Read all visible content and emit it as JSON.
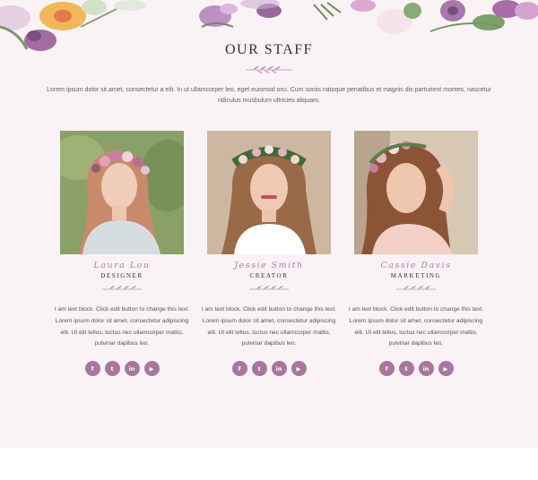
{
  "section": {
    "title": "OUR STAFF",
    "intro": "Lorem ipsum dolor sit amet, consectetur a elit. In ut ullamcorper leo, eget euismod orci. Cum sociis natoque penatibus et magnis dis parturient montes, nascetur ridiculus musbulum ultricies aliquam."
  },
  "colors": {
    "accent": "#a7779e",
    "name": "#b07ca8",
    "background": "#faf3f5"
  },
  "staff": [
    {
      "name": "Laura Lou",
      "role": "DESIGNER",
      "bio": "I am text block. Click edit button to change this text. Lorem ipsum dolor sit amet, consectetur adipiscing elit. Ut elit tellus, luctus nec ullamcorper mattis, pulvinar dapibus leo.",
      "socials": [
        {
          "icon": "facebook-icon",
          "glyph": "f"
        },
        {
          "icon": "twitter-icon",
          "glyph": "t"
        },
        {
          "icon": "linkedin-icon",
          "glyph": "in"
        },
        {
          "icon": "youtube-icon",
          "glyph": "▶"
        }
      ]
    },
    {
      "name": "Jessie Smith",
      "role": "CREATOR",
      "bio": "I am text block. Click edit button to change this text. Lorem ipsum dolor sit amet, consectetur adipiscing elit. Ut elit tellus, luctus nec ullamcorper mattis, pulvinar dapibus leo.",
      "socials": [
        {
          "icon": "facebook-icon",
          "glyph": "f"
        },
        {
          "icon": "twitter-icon",
          "glyph": "t"
        },
        {
          "icon": "linkedin-icon",
          "glyph": "in"
        },
        {
          "icon": "youtube-icon",
          "glyph": "▶"
        }
      ]
    },
    {
      "name": "Cassie Davis",
      "role": "MARKETING",
      "bio": "I am text block. Click edit button to change this text. Lorem ipsum dolor sit amet, consectetur adipiscing elit. Ut elit tellus, luctus nec ullamcorper mattis, pulvinar dapibus leo.",
      "socials": [
        {
          "icon": "facebook-icon",
          "glyph": "f"
        },
        {
          "icon": "twitter-icon",
          "glyph": "t"
        },
        {
          "icon": "linkedin-icon",
          "glyph": "in"
        },
        {
          "icon": "youtube-icon",
          "glyph": "▶"
        }
      ]
    }
  ]
}
